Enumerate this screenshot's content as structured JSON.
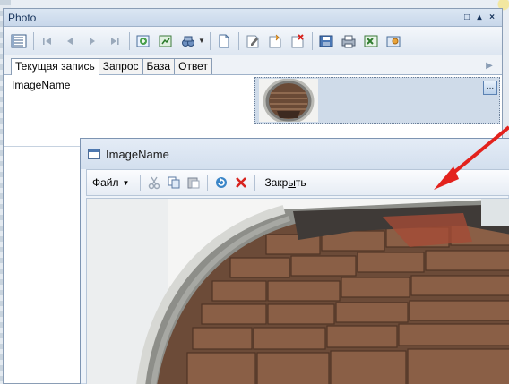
{
  "photo_window": {
    "title": "Photo",
    "controls": {
      "minimize": "_",
      "restore": "□",
      "pin": "▴",
      "close": "×"
    }
  },
  "toolbar": {
    "icons": [
      "grid-view-icon",
      "first-record-icon",
      "prev-record-icon",
      "next-record-icon",
      "last-record-icon",
      "refresh-icon",
      "export-icon",
      "binoculars-icon",
      "new-record-icon",
      "edit-record-icon",
      "copy-record-icon",
      "delete-record-icon",
      "save-icon",
      "print-icon",
      "excel-icon",
      "settings-icon"
    ]
  },
  "tabs": [
    {
      "label": "Текущая запись",
      "active": true
    },
    {
      "label": "Запрос",
      "active": false
    },
    {
      "label": "База",
      "active": false
    },
    {
      "label": "Ответ",
      "active": false
    }
  ],
  "record": {
    "field_label": "ImageName",
    "ellipsis": "..."
  },
  "image_window": {
    "title": "ImageName",
    "menu_file": "Файл",
    "close_label_pre": "Закр",
    "close_label_ul": "ы",
    "close_label_post": "ть"
  },
  "colors": {
    "accent_arrow": "#e3221d",
    "delete_x": "#d8231e",
    "panel_title": "#15325a"
  }
}
